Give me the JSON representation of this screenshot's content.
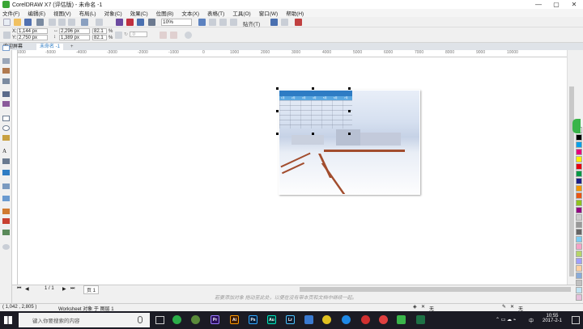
{
  "window": {
    "title": "CorelDRAW X7 (评估版) - 未命名 -1",
    "minimize": "—",
    "restore": "▢",
    "close": "✕"
  },
  "menu": [
    "文件(F)",
    "编辑(E)",
    "视图(V)",
    "布局(L)",
    "对象(C)",
    "效果(C)",
    "位图(B)",
    "文本(X)",
    "表格(T)",
    "工具(O)",
    "窗口(W)",
    "帮助(H)"
  ],
  "toolbar": {
    "zoom": "10%",
    "snap_label": "贴齐(T)"
  },
  "property_bar": {
    "x_label": "X:",
    "x_value": "1,144 px",
    "y_label": "Y:",
    "y_value": "2,750 px",
    "w_value": "2,296 px",
    "h_value": "1,389 px",
    "scale_w": "82.1",
    "scale_h": "82.1",
    "percent": "%",
    "angle": ".0"
  },
  "tabs": {
    "welcome": "欢迎屏幕",
    "doc": "未命名 -1",
    "add": "+"
  },
  "ruler": [
    "-6000",
    "-5000",
    "-4000",
    "-3000",
    "-2000",
    "-1000",
    "0",
    "1000",
    "2000",
    "3000",
    "4000",
    "5000",
    "6000",
    "7000",
    "8000",
    "9000",
    "10000"
  ],
  "spreadsheet": {
    "title": "",
    "months": [
      "1月",
      "2月",
      "3月",
      "4月",
      "5月",
      "6月",
      "7月"
    ]
  },
  "page_nav": {
    "current": "1 / 1",
    "page_tab": "页 1"
  },
  "hint": "若要添加对象 拖动至此处，以便在没有带本页和文档中继续一起。",
  "status": {
    "coords": "( 1,042 , 2,805 )",
    "object": "Worksheet 对象 于 图层 1",
    "fill_label": "无",
    "outline_label": "无"
  },
  "taskbar": {
    "search_placeholder": "键入你要搜索的内容",
    "time": "10:55",
    "date": "2017-2-1",
    "ime": "中",
    "apps": [
      {
        "label": "Pr",
        "color": "#2a0e5a"
      },
      {
        "label": "Ai",
        "color": "#3e1a00"
      },
      {
        "label": "Ps",
        "color": "#061e3c"
      },
      {
        "label": "Au",
        "color": "#003c3a"
      },
      {
        "label": "Lr",
        "color": "#101a2e"
      }
    ]
  },
  "colors": {
    "accent": "#2e7cc4",
    "palette": [
      "#ffffff",
      "#000000",
      "#00a0e9",
      "#e4007f",
      "#fff100",
      "#e60012",
      "#009944",
      "#1d2088",
      "#f39800",
      "#ea5514",
      "#8fc31f",
      "#920783",
      "#cccccc",
      "#999999",
      "#666666",
      "#7ecef4",
      "#f5a3c7",
      "#b5d568",
      "#a0a0ff",
      "#ffd1a3",
      "#88abda",
      "#c0c0c0",
      "#bfe3f3",
      "#e6c0dc",
      "#d4ecb4",
      "#5bb8e5",
      "#a8d9ee",
      "#2a8fd4"
    ]
  }
}
